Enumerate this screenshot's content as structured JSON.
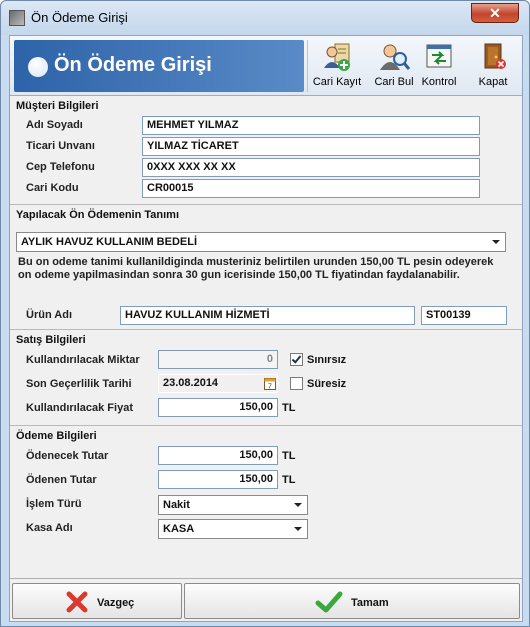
{
  "window": {
    "title": "Ön Ödeme Girişi",
    "close_glyph": "✕"
  },
  "banner": {
    "title": "Ön Ödeme Girişi"
  },
  "toolbar": [
    {
      "id": "cari-kayit",
      "label": "Cari Kayıt",
      "icon": "user-add-icon"
    },
    {
      "id": "cari-bul",
      "label": "Cari Bul",
      "icon": "user-search-icon"
    },
    {
      "id": "kontrol",
      "label": "Kontrol",
      "icon": "control-icon"
    },
    {
      "id": "kapat",
      "label": "Kapat",
      "icon": "exit-door-icon"
    }
  ],
  "customer": {
    "section": "Müşteri Bilgileri",
    "name_label": "Adı Soyadı",
    "name": "MEHMET YILMAZ",
    "trade_label": "Ticari Unvanı",
    "trade": "YILMAZ TİCARET",
    "phone_label": "Cep Telefonu",
    "phone": "0XXX XXX XX XX",
    "code_label": "Cari Kodu",
    "code": "CR00015"
  },
  "prepayment": {
    "section": "Yapılacak Ön Ödemenin Tanımı",
    "definition": "AYLIK HAVUZ KULLANIM BEDELİ",
    "description": "Bu on odeme tanimi kullanildiginda musteriniz belirtilen urunden 150,00 TL pesin odeyerek on odeme yapilmasindan sonra 30 gun icerisinde  150,00 TL fiyatindan faydalanabilir.",
    "product_label": "Ürün Adı",
    "product": "HAVUZ KULLANIM HİZMETİ",
    "product_code": "ST00139"
  },
  "sales": {
    "section": "Satış Bilgileri",
    "qty_label": "Kullandırılacak Miktar",
    "qty": "0",
    "unlimited_label": "Sınırsız",
    "unlimited": true,
    "expiry_label": "Son Geçerlilik Tarihi",
    "expiry": "23.08.2014",
    "calendar_day": "7",
    "nolimit_label": "Süresiz",
    "nolimit": false,
    "price_label": "Kullandırılacak Fiyat",
    "price": "150,00",
    "price_unit": "TL"
  },
  "payment": {
    "section": "Ödeme Bilgileri",
    "due_label": "Ödenecek Tutar",
    "due": "150,00",
    "due_unit": "TL",
    "paid_label": "Ödenen Tutar",
    "paid": "150,00",
    "paid_unit": "TL",
    "type_label": "İşlem Türü",
    "type": "Nakit",
    "cash_label": "Kasa Adı",
    "cash": "KASA"
  },
  "footer": {
    "cancel": "Vazgeç",
    "ok": "Tamam"
  }
}
